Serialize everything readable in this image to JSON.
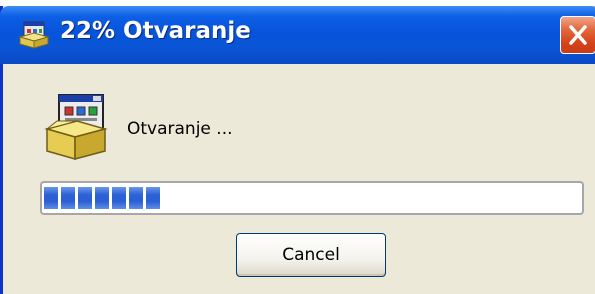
{
  "window": {
    "title": "22% Otvaranje",
    "status_text": "Otvaranje ...",
    "progress_percent": 22,
    "cancel_label": "Cancel"
  },
  "icons": {
    "title_icon": "installer-icon",
    "app_icon": "installer-box-icon",
    "close_icon": "close-icon"
  },
  "colors": {
    "titlebar": "#0754db",
    "window_bg": "#ece9d8",
    "close_button": "#d6451b",
    "progress_block": "#2c62d6"
  }
}
